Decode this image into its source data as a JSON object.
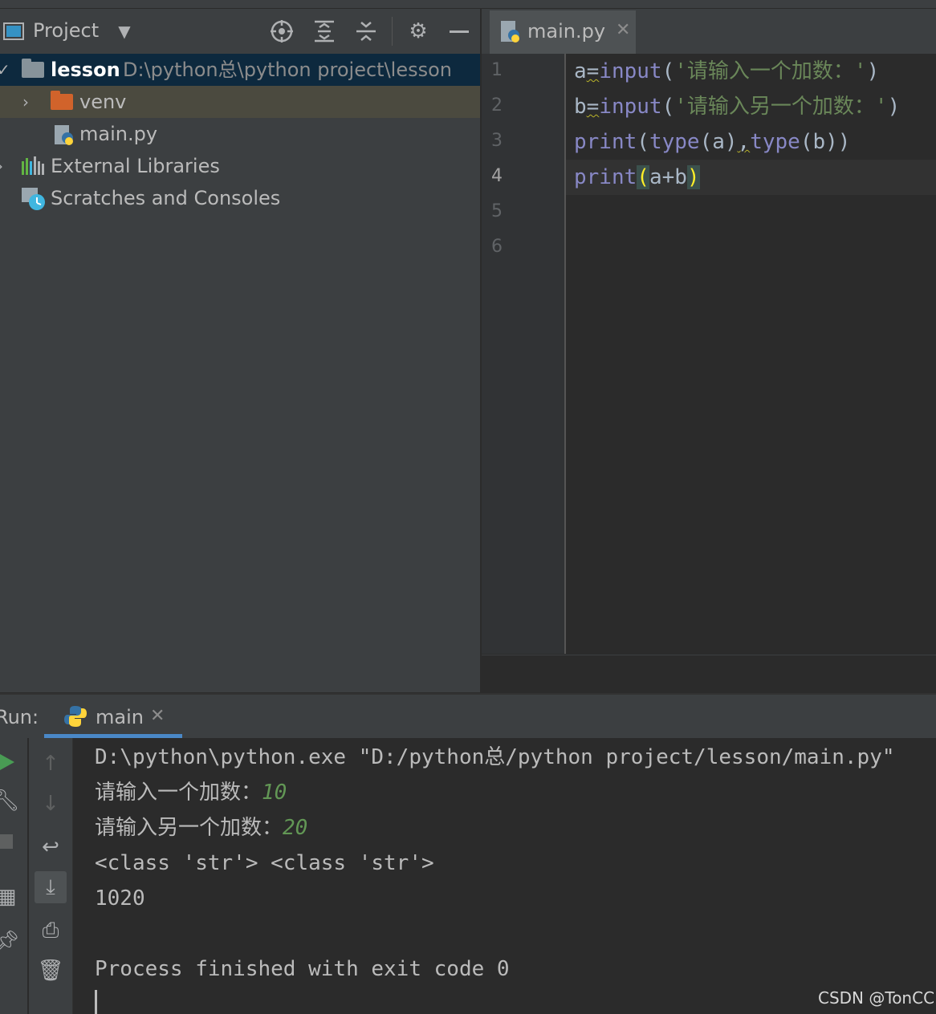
{
  "project_panel": {
    "title": "Project",
    "tree": [
      {
        "name": "lesson",
        "path": "D:\\python总\\python project\\lesson"
      },
      {
        "name": "venv"
      },
      {
        "name": "main.py"
      },
      {
        "name": "External Libraries"
      },
      {
        "name": "Scratches and Consoles"
      }
    ]
  },
  "editor": {
    "tab_label": "main.py",
    "line_numbers": [
      "1",
      "2",
      "3",
      "4",
      "5",
      "6"
    ],
    "code": {
      "l1": {
        "a": "a",
        "eq": "=",
        "fn": "input",
        "open": "(",
        "str": "'请输入一个加数：'",
        "close": ")"
      },
      "l2": {
        "a": "b",
        "eq": "=",
        "fn": "input",
        "open": "(",
        "str": "'请输入另一个加数：'",
        "close": ")"
      },
      "l3": {
        "fn1": "print",
        "open": "(",
        "fn2": "type",
        "arg1": "(a)",
        "comma": ",",
        "fn3": "type",
        "arg2": "(b))"
      },
      "l4": {
        "fn": "print",
        "open": "(",
        "arg": "a+b",
        "close": ")"
      }
    }
  },
  "run_panel": {
    "label": "Run:",
    "tab_label": "main",
    "console": {
      "cmd": "D:\\python\\python.exe \"D:/python总/python project/lesson/main.py\"",
      "prompt1": "请输入一个加数：",
      "input1": "10",
      "prompt2": "请输入另一个加数：",
      "input2": "20",
      "types": "<class 'str'> <class 'str'>",
      "result": "1020",
      "finished": "Process finished with exit code 0"
    }
  },
  "watermark": "CSDN @TonCC"
}
